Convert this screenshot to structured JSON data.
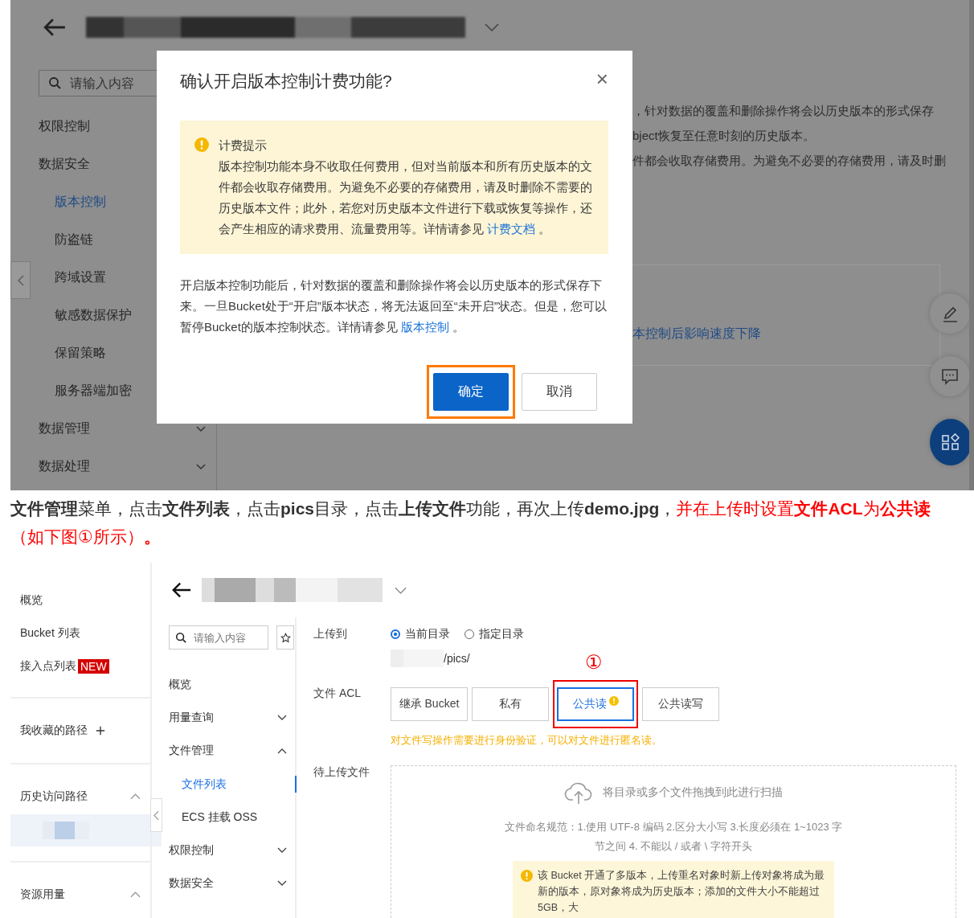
{
  "top_screenshot": {
    "sidebar_search": {
      "placeholder": "请输入内容"
    },
    "sidebar_items": [
      {
        "label": "权限控制",
        "selected": false
      },
      {
        "label": "数据安全",
        "selected": false,
        "children": [
          {
            "label": "版本控制",
            "selected": true
          },
          {
            "label": "防盗链",
            "selected": false
          },
          {
            "label": "跨域设置",
            "selected": false
          },
          {
            "label": "敏感数据保护",
            "selected": false
          },
          {
            "label": "保留策略",
            "selected": false
          },
          {
            "label": "服务器端加密",
            "selected": false
          }
        ]
      },
      {
        "label": "数据管理",
        "selected": false,
        "expanded": false
      },
      {
        "label": "数据处理",
        "selected": false,
        "expanded": false
      }
    ],
    "background_lines": [
      "，针对数据的覆盖和删除操作将会以历史版本的形式保存",
      "bject恢复至任意时刻的历史版本。",
      "件都会收取存储费用。为避免不必要的存储费用，请及时删"
    ],
    "background_link": "本控制后影响速度下降",
    "dialog": {
      "title": "确认开启版本控制计费功能?",
      "close": "×",
      "notice": {
        "title": "计费提示",
        "text": "版本控制功能本身不收取任何费用，但对当前版本和所有历史版本的文件都会收取存储费用。为避免不必要的存储费用，请及时删除不需要的历史版本文件；此外，若您对历史版本文件进行下载或恢复等操作，还会产生相应的请求费用、流量费用等。详情请参见 ",
        "link": "计费文档",
        "tail": " 。"
      },
      "body": {
        "text": "开启版本控制功能后，针对数据的覆盖和删除操作将会以历史版本的形式保存下来。一旦Bucket处于“开启”版本状态，将无法返回至“未开启”状态。但是，您可以暂停Bucket的版本控制状态。详情请参见 ",
        "link": "版本控制",
        "tail": " 。"
      },
      "buttons": [
        {
          "label": "确定",
          "kind": "primary",
          "highlighted": true
        },
        {
          "label": "取消",
          "kind": "default",
          "highlighted": false
        }
      ]
    }
  },
  "instruction": [
    {
      "text": "**文件管理**菜单，点击**文件列表**，点击**pics**目录，点击**上传文件**功能，再次上传**demo.jpg**，",
      "emphasis": false
    },
    {
      "text": "并在上传时设置**文件ACL**为**公共读**（如下图①所示）**。**",
      "emphasis": true
    }
  ],
  "bottom_screenshot": {
    "sidebar": [
      {
        "kind": "link",
        "label": "概览"
      },
      {
        "kind": "link",
        "label": "Bucket 列表"
      },
      {
        "kind": "link",
        "label": "接入点列表",
        "badge": "NEW"
      },
      {
        "kind": "addable",
        "label": "我收藏的路径"
      },
      {
        "kind": "group",
        "label": "历史访问路径",
        "expanded": true
      },
      {
        "kind": "redacted",
        "selected": true
      },
      {
        "kind": "group",
        "label": "资源用量",
        "expanded": true
      }
    ],
    "nav_search": {
      "placeholder": "请输入内容"
    },
    "nav": [
      {
        "label": "概览",
        "selected": false
      },
      {
        "label": "用量查询",
        "selected": false,
        "expanded": false
      },
      {
        "label": "文件管理",
        "selected": false,
        "expanded": true,
        "children": [
          {
            "label": "文件列表",
            "selected": true
          },
          {
            "label": "ECS 挂载 OSS",
            "selected": false
          }
        ]
      },
      {
        "label": "权限控制",
        "selected": false,
        "expanded": false
      },
      {
        "label": "数据安全",
        "selected": false,
        "expanded": false
      }
    ],
    "form": {
      "upload_to": {
        "label": "上传到",
        "options": [
          {
            "label": "当前目录",
            "selected": true
          },
          {
            "label": "指定目录",
            "selected": false
          }
        ],
        "path": "/pics/"
      },
      "acl": {
        "label": "文件 ACL",
        "marker": "①",
        "options": [
          {
            "label": "继承 Bucket",
            "selected": false,
            "warning": false,
            "highlighted": false
          },
          {
            "label": "私有",
            "selected": false,
            "warning": false,
            "highlighted": false
          },
          {
            "label": "公共读",
            "selected": true,
            "warning": true,
            "highlighted": true
          },
          {
            "label": "公共读写",
            "selected": false,
            "warning": false,
            "highlighted": false
          }
        ],
        "hint": "对文件写操作需要进行身份验证，可以对文件进行匿名读。"
      },
      "files": {
        "label": "待上传文件",
        "drop_text": "将目录或多个文件拖拽到此进行扫描",
        "rules": "文件命名规范：1.使用 UTF-8 编码 2.区分大小写 3.长度必须在 1~1023 字节之间 4. 不能以 / 或者 \\ 字符开头",
        "notice": "该 Bucket 开通了多版本，上传重名对象时新上传对象将成为最新的版本，原对象将成为历史版本；添加的文件大小不能超过 5GB，大"
      }
    }
  }
}
